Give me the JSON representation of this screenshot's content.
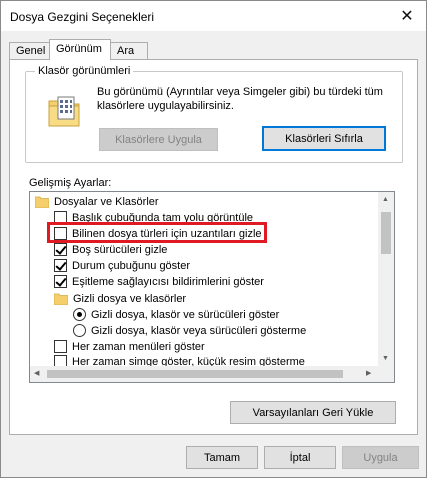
{
  "window": {
    "title": "Dosya Gezgini Seçenekleri"
  },
  "tabs": [
    {
      "label": "Genel",
      "active": false
    },
    {
      "label": "Görünüm",
      "active": true
    },
    {
      "label": "Ara",
      "active": false
    }
  ],
  "folder_views": {
    "title": "Klasör görünümleri",
    "description": "Bu görünümü (Ayrıntılar veya Simgeler gibi) bu türdeki tüm klasörlere uygulayabilirsiniz.",
    "apply_button": "Klasörlere Uygula",
    "reset_button": "Klasörleri Sıfırla"
  },
  "advanced": {
    "label": "Gelişmiş Ayarlar:",
    "items": [
      {
        "type": "folder",
        "label": "Dosyalar ve Klasörler"
      },
      {
        "type": "checkbox",
        "label": "Başlık çubuğunda tam yolu görüntüle",
        "checked": false
      },
      {
        "type": "checkbox",
        "label": "Bilinen dosya türleri için uzantıları gizle",
        "checked": false
      },
      {
        "type": "checkbox",
        "label": "Boş sürücüleri gizle",
        "checked": true
      },
      {
        "type": "checkbox",
        "label": "Durum çubuğunu göster",
        "checked": true
      },
      {
        "type": "checkbox",
        "label": "Eşitleme sağlayıcısı bildirimlerini göster",
        "checked": true
      },
      {
        "type": "folder",
        "label": "Gizli dosya ve klasörler"
      },
      {
        "type": "radio",
        "label": "Gizli dosya, klasör ve sürücüleri göster",
        "checked": true
      },
      {
        "type": "radio",
        "label": "Gizli dosya, klasör veya sürücüleri gösterme",
        "checked": false
      },
      {
        "type": "checkbox",
        "label": "Her zaman menüleri göster",
        "checked": false
      },
      {
        "type": "checkbox",
        "label": "Her zaman simge göster, küçük resim gösterme",
        "checked": false
      }
    ]
  },
  "restore_defaults_button": "Varsayılanları Geri Yükle",
  "footer": {
    "ok": "Tamam",
    "cancel": "İptal",
    "apply": "Uygula"
  },
  "colors": {
    "highlight": "#e01a22",
    "focus": "#0078d7",
    "folder": "#f4cf6c"
  },
  "icons": {
    "close": "close-icon",
    "folder_views": "folder-grid-icon",
    "tree_folder": "folder-icon"
  }
}
